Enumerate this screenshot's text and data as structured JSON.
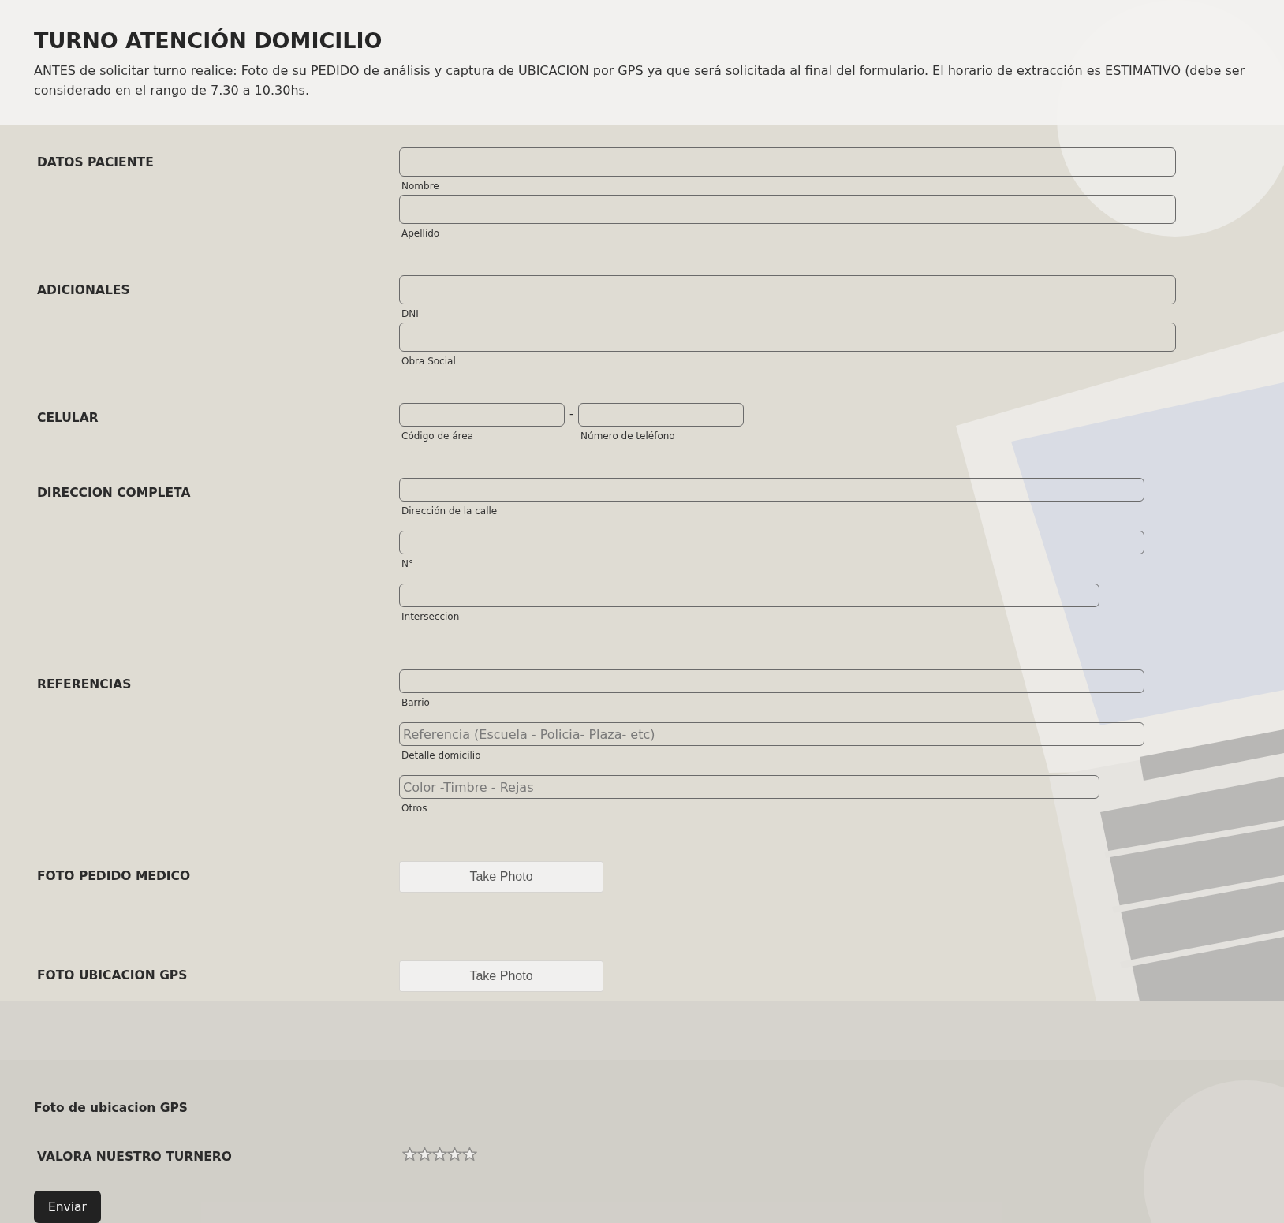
{
  "header": {
    "title": "TURNO ATENCIÓN DOMICILIO",
    "description": "ANTES de solicitar turno realice: Foto de su PEDIDO de análisis y captura de UBICACION por GPS ya que será solicitada al final del formulario. El horario de extracción es ESTIMATIVO (debe ser considerado en el rango de 7.30 a 10.30hs."
  },
  "sections": [
    {
      "label": "DATOS PACIENTE",
      "kind": "fields",
      "fields": [
        {
          "kind": "wide",
          "sublabel": "Nombre"
        },
        {
          "kind": "wide",
          "sublabel": "Apellido"
        }
      ]
    },
    {
      "label": "ADICIONALES",
      "kind": "fields",
      "fields": [
        {
          "kind": "wide",
          "sublabel": "DNI"
        },
        {
          "kind": "wide",
          "sublabel": "Obra Social"
        }
      ]
    },
    {
      "label": "CELULAR",
      "kind": "phone",
      "separator": "-",
      "fields": [
        {
          "kind": "short",
          "sublabel": "Código de área"
        },
        {
          "kind": "short",
          "sublabel": "Número de teléfono"
        }
      ]
    },
    {
      "label": "DIRECCION COMPLETA",
      "kind": "fields",
      "fields": [
        {
          "kind": "long",
          "sublabel": "Dirección de la calle"
        },
        {
          "kind": "long",
          "sublabel": "N°"
        },
        {
          "kind": "medium",
          "sublabel": "Interseccion"
        }
      ]
    },
    {
      "label": "REFERENCIAS",
      "kind": "fields",
      "fields": [
        {
          "kind": "long",
          "sublabel": "Barrio"
        },
        {
          "kind": "long",
          "placeholder": "Referencia (Escuela - Policia- Plaza- etc)",
          "sublabel": "Detalle domicilio"
        },
        {
          "kind": "medium",
          "placeholder": "Color -Timbre - Rejas",
          "sublabel": "Otros"
        }
      ]
    },
    {
      "label": "FOTO PEDIDO MEDICO",
      "button": "Take Photo"
    },
    {
      "label": "FOTO UBICACION GPS",
      "button": "Take Photo"
    }
  ],
  "footer": {
    "heading": "Foto de ubicacion GPS",
    "rating": {
      "label": "VALORA NUESTRO TURNERO",
      "stars": 0
    },
    "submit": "Enviar"
  }
}
